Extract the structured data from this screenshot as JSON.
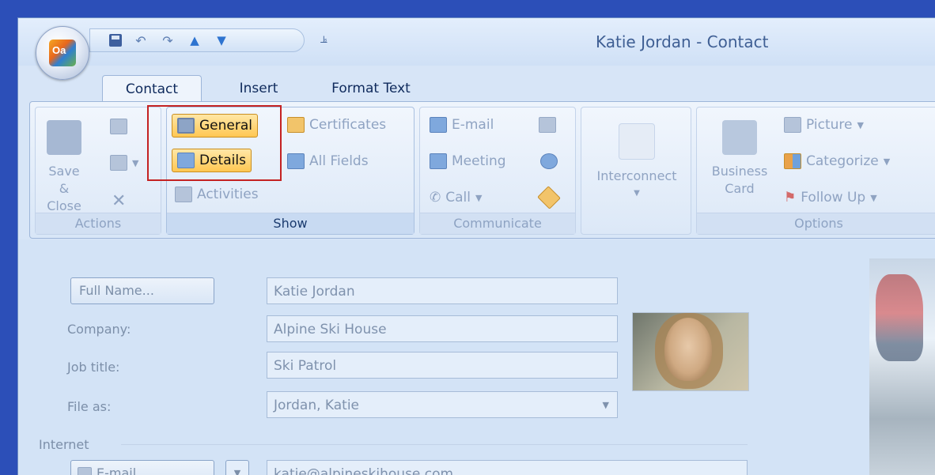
{
  "window": {
    "title": "Katie Jordan - Contact"
  },
  "tabs": [
    {
      "label": "Contact"
    },
    {
      "label": "Insert"
    },
    {
      "label": "Format Text"
    }
  ],
  "ribbon": {
    "actions": {
      "save_close": "Save & Close",
      "label": "Actions"
    },
    "show": {
      "general": "General",
      "details": "Details",
      "activities": "Activities",
      "certificates": "Certificates",
      "all_fields": "All Fields",
      "label": "Show"
    },
    "communicate": {
      "email": "E-mail",
      "meeting": "Meeting",
      "call": "Call",
      "label": "Communicate"
    },
    "interconnect": {
      "label": "Interconnect"
    },
    "options": {
      "business_card": "Business Card",
      "picture": "Picture",
      "categorize": "Categorize",
      "follow_up": "Follow Up",
      "label": "Options"
    }
  },
  "form": {
    "full_name_button": "Full Name...",
    "full_name_value": "Katie Jordan",
    "company_label": "Company:",
    "company_value": "Alpine Ski House",
    "job_title_label": "Job title:",
    "job_title_value": "Ski Patrol",
    "file_as_label": "File as:",
    "file_as_value": "Jordan, Katie",
    "internet_label": "Internet",
    "email_button": "E-mail...",
    "email_value": "katie@alpineskihouse.com"
  },
  "colors": {
    "highlight": "#ffc752",
    "annotation_box": "#c42222",
    "background": "#2c4fb8"
  }
}
